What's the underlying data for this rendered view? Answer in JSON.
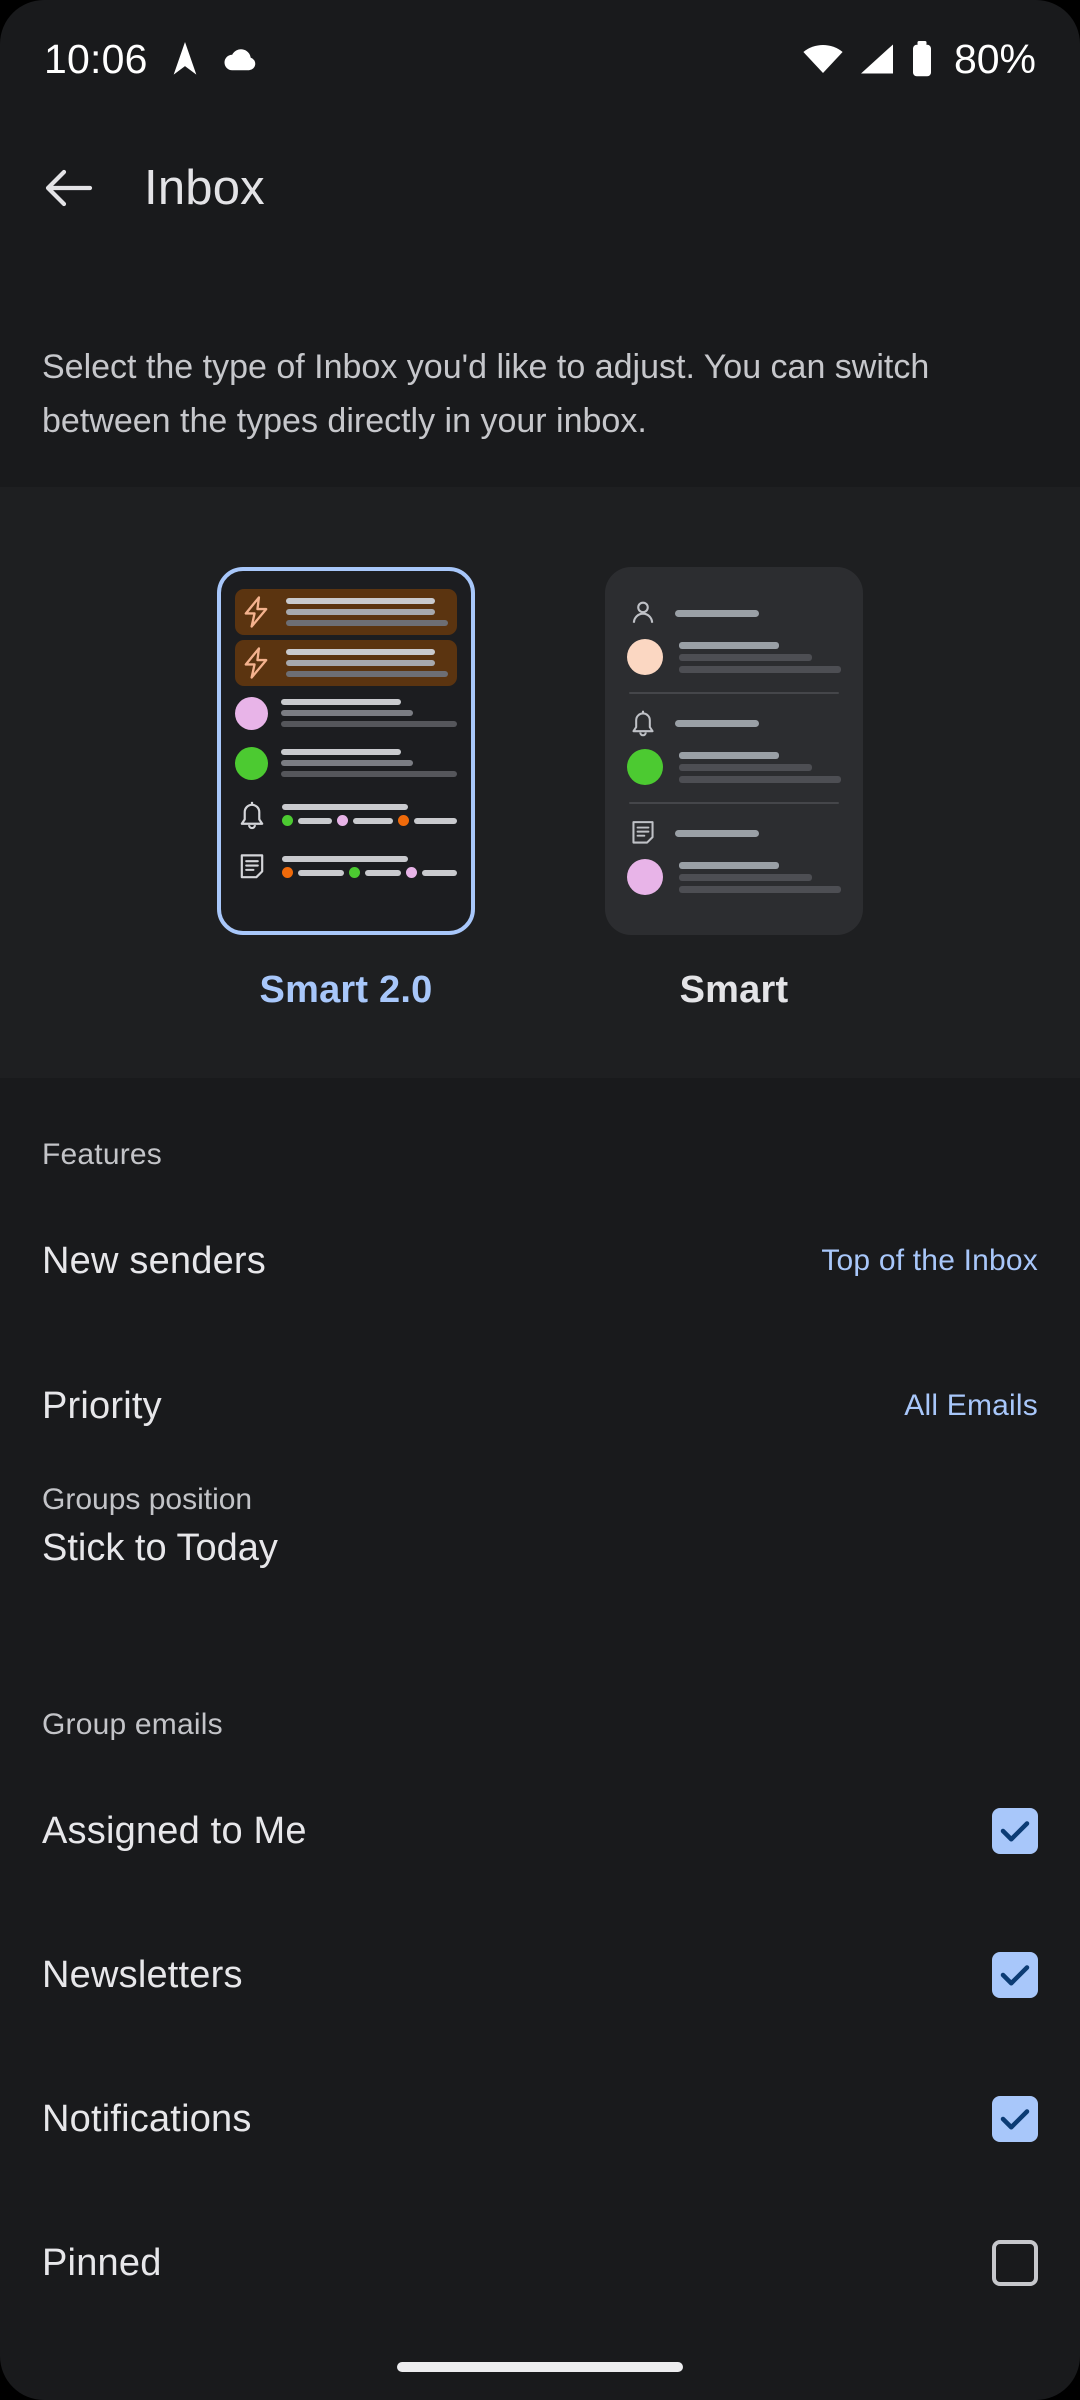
{
  "status_bar": {
    "time": "10:06",
    "battery_percent": "80%",
    "icons": [
      "navigation-icon",
      "cloud-icon",
      "wifi-icon",
      "cellular-signal-icon",
      "battery-icon"
    ]
  },
  "app_bar": {
    "back_icon": "back-arrow-icon",
    "title": "Inbox"
  },
  "description": "Select the type of Inbox you'd like to adjust. You can switch between the types directly in your inbox.",
  "inbox_types": [
    {
      "id": "smart-2",
      "label": "Smart 2.0",
      "selected": true,
      "accent_color": "#A8C7FA",
      "preview_rows": [
        {
          "kind": "highlight",
          "icon": "lightning-bolt-icon",
          "icon_color": "#F4B28E",
          "bg": "#5B3410"
        },
        {
          "kind": "highlight",
          "icon": "lightning-bolt-icon",
          "icon_color": "#F4B28E",
          "bg": "#5B3410"
        },
        {
          "kind": "avatar",
          "avatar_color": "#E8B4E8"
        },
        {
          "kind": "avatar",
          "avatar_color": "#4CCA31"
        },
        {
          "kind": "group",
          "icon": "bell-icon",
          "dot_colors": [
            "#4CCA31",
            "#E8B4E8",
            "#F06A0A"
          ]
        },
        {
          "kind": "group",
          "icon": "document-icon",
          "dot_colors": [
            "#F06A0A",
            "#4CCA31",
            "#E8B4E8"
          ]
        }
      ]
    },
    {
      "id": "smart",
      "label": "Smart",
      "selected": false,
      "accent_color": "#E4E4E7",
      "preview_groups": [
        {
          "icon": "person-icon",
          "avatar_color": "#FBD7C2"
        },
        {
          "icon": "bell-icon",
          "avatar_color": "#4CCA31"
        },
        {
          "icon": "document-icon",
          "avatar_color": "#E8B4E8"
        }
      ]
    }
  ],
  "features": {
    "header": "Features",
    "items": [
      {
        "title": "New senders",
        "value": "Top of the Inbox"
      },
      {
        "title": "Priority",
        "value": "All Emails"
      }
    ],
    "groups_position": {
      "label": "Groups position",
      "value": "Stick to Today"
    }
  },
  "group_emails": {
    "header": "Group emails",
    "items": [
      {
        "title": "Assigned to Me",
        "checked": true
      },
      {
        "title": "Newsletters",
        "checked": true
      },
      {
        "title": "Notifications",
        "checked": true
      },
      {
        "title": "Pinned",
        "checked": false
      }
    ]
  },
  "colors": {
    "background": "#191A1C",
    "panel": "#1E1F21",
    "accent": "#A8C7FA",
    "text_primary": "#E7E7EA",
    "text_secondary": "#C3C4C8"
  }
}
